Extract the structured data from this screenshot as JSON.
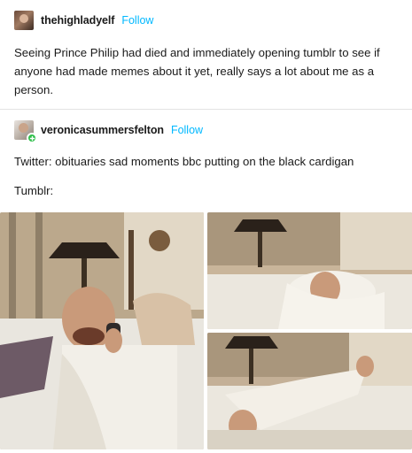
{
  "posts": [
    {
      "username": "thehighladyelf",
      "follow_label": "Follow",
      "text": "Seeing Prince Philip had died and immediately opening tumblr to see if anyone had made memes about it yet, really says a lot about me as a person."
    },
    {
      "username": "veronicasummersfelton",
      "follow_label": "Follow",
      "line1": "Twitter: obituaries sad moments bbc putting on the black cardigan",
      "line2": "Tumblr:"
    }
  ],
  "icons": {
    "avatar1": "user-avatar-icon",
    "avatar2": "user-avatar-icon",
    "badge": "plus-badge-icon"
  },
  "colors": {
    "accent": "#00b8ff",
    "badge": "#2fbf4a"
  }
}
